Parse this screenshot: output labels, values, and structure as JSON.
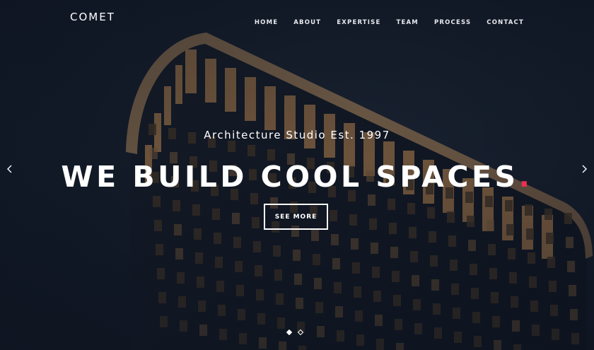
{
  "brand": {
    "name": "COMET"
  },
  "nav": {
    "items": [
      "HOME",
      "ABOUT",
      "EXPERTISE",
      "TEAM",
      "PROCESS",
      "CONTACT"
    ]
  },
  "hero": {
    "subtitle": "Architecture Studio Est. 1997",
    "headline": "WE BUILD COOL SPACES",
    "headline_dot": ".",
    "cta_label": "SEE MORE",
    "slides_count": 2,
    "active_slide": 1
  },
  "icons": {
    "prev": "chevron-left-icon",
    "next": "chevron-right-icon"
  },
  "colors": {
    "background": "#131c2b",
    "accent": "#e8304e",
    "text": "#ffffff"
  }
}
